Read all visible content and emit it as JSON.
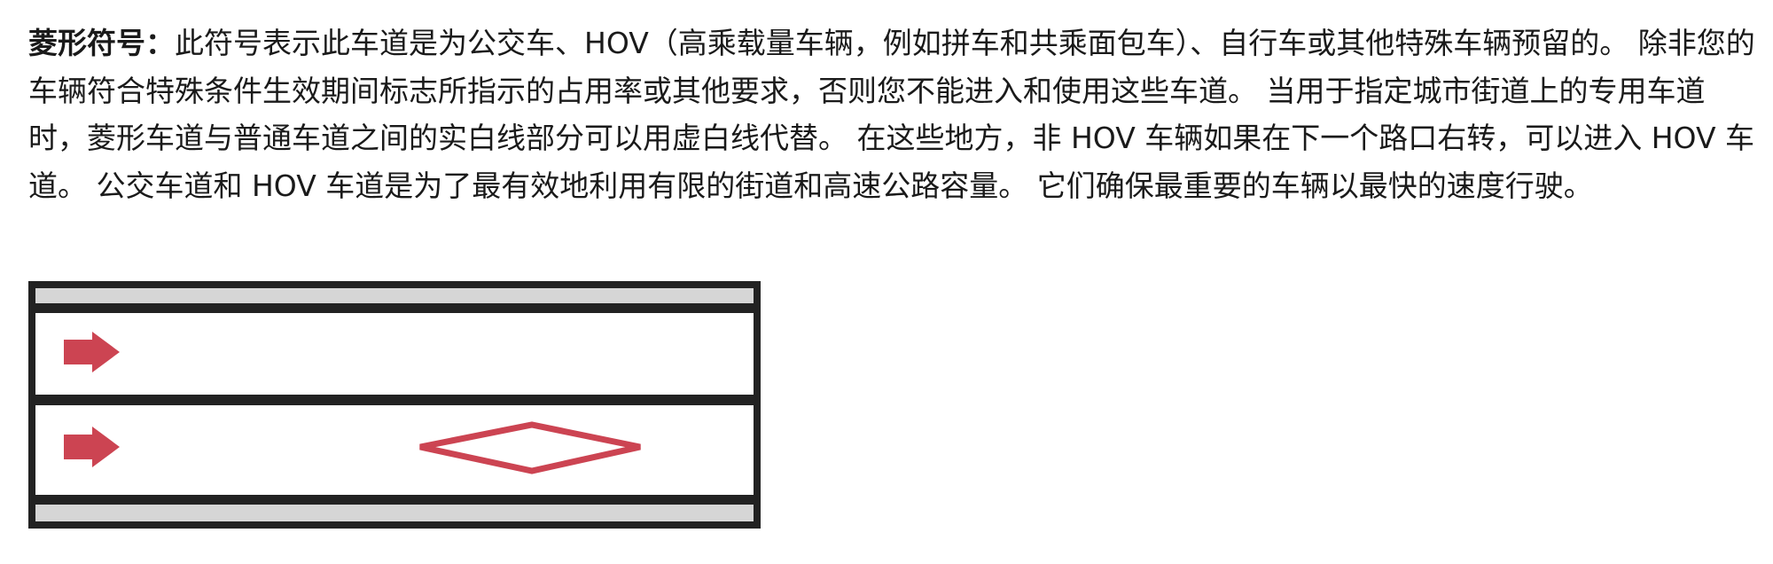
{
  "definition": {
    "term": "菱形符号：",
    "body": "此符号表示此车道是为公交车、HOV（高乘载量车辆，例如拼车和共乘面包车）、自行车或其他特殊车辆预留的。 除非您的车辆符合特殊条件生效期间标志所指示的占用率或其他要求，否则您不能进入和使用这些车道。 当用于指定城市街道上的专用车道时，菱形车道与普通车道之间的实白线部分可以用虚白线代替。 在这些地方，非 HOV 车辆如果在下一个路口右转，可以进入 HOV 车道。 公交车道和 HOV 车道是为了最有效地利用有限的街道和高速公路容量。 它们确保最重要的车辆以最快的速度行驶。"
  },
  "diagram": {
    "lanes": [
      {
        "direction": "forward",
        "diamond": false
      },
      {
        "direction": "forward",
        "diamond": true
      }
    ],
    "colors": {
      "border": "#222222",
      "shoulder": "#d6d6d6",
      "lane": "#ffffff",
      "marking": "#cc4452"
    }
  }
}
